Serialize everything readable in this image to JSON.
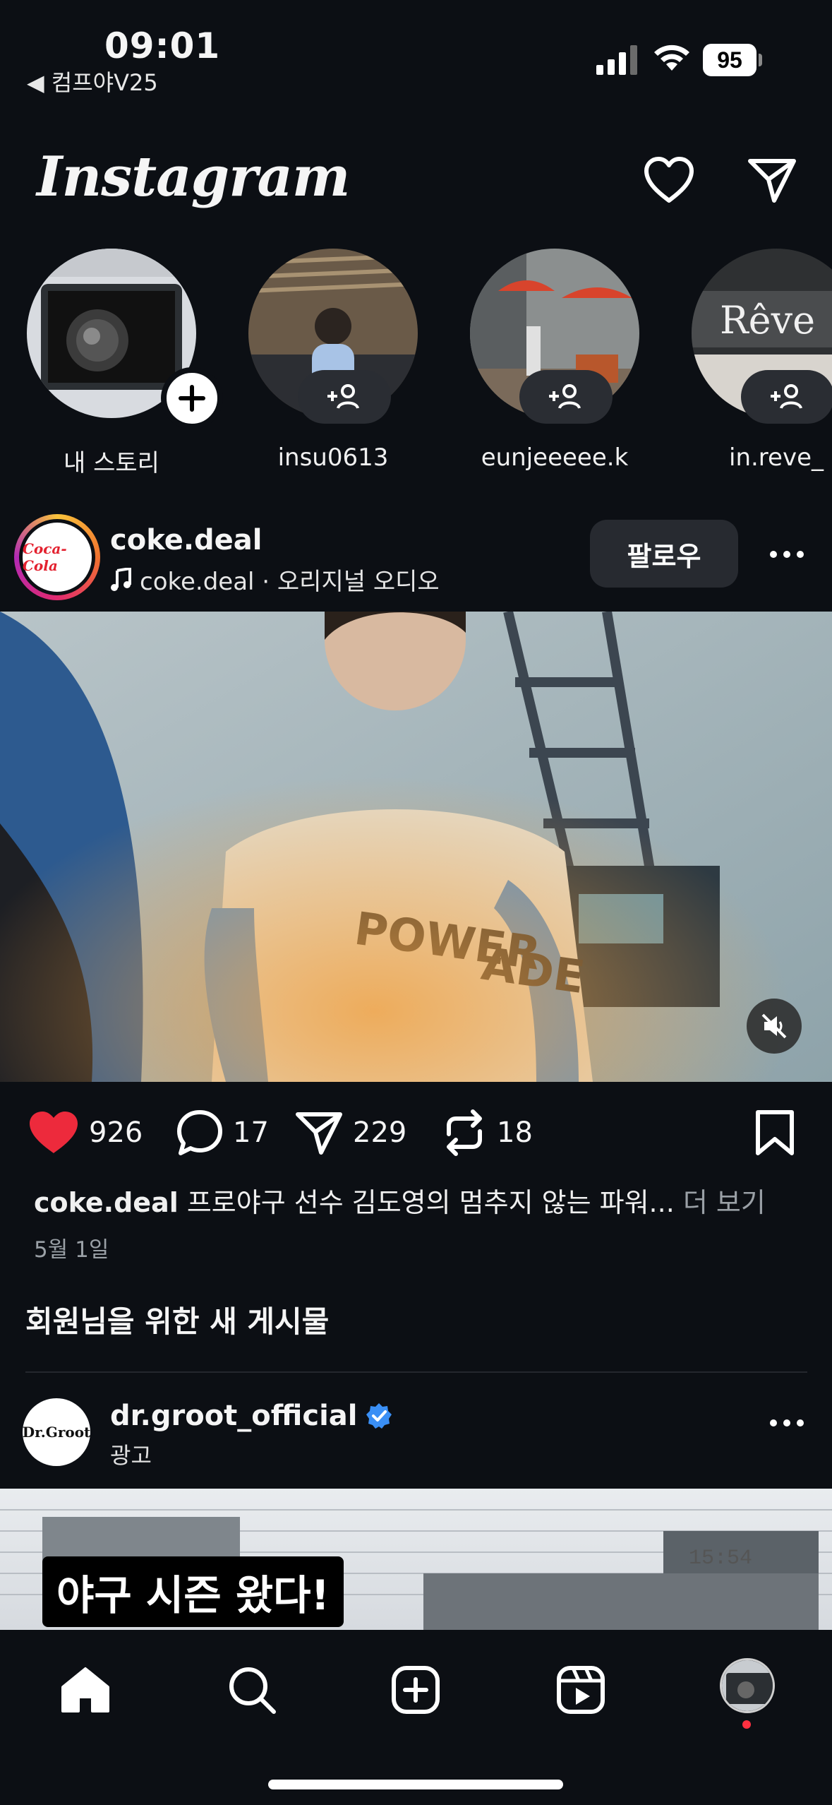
{
  "status": {
    "time": "09:01",
    "back_app": "◀ 컴프야V25",
    "battery": "95"
  },
  "header": {
    "logo": "Instagram"
  },
  "stories": [
    {
      "name": "내 스토리",
      "type": "own"
    },
    {
      "name": "insu0613",
      "type": "suggest"
    },
    {
      "name": "eunjeeeee.k",
      "type": "suggest"
    },
    {
      "name": "in.reve_",
      "type": "suggest"
    }
  ],
  "post": {
    "username": "coke.deal",
    "audio": "coke.deal · 오리지널 오디오",
    "avatar_text": "Coca-Cola",
    "follow_label": "팔로우",
    "likes": "926",
    "comments": "17",
    "shares": "229",
    "reposts": "18",
    "caption_user": "coke.deal",
    "caption_text": " 프로야구 선수 김도영의 멈추지 않는 파워...",
    "caption_more": " 더 보기",
    "date": "5월 1일",
    "jersey_text": "POWERADE"
  },
  "section": {
    "title": "회원님을 위한 새 게시물"
  },
  "post2": {
    "username": "dr.groot_official",
    "subtitle": "광고",
    "avatar_text": "Dr.Groot",
    "ad_headline": "야구 시즌 왔다!",
    "score_time": "15:54"
  },
  "colors": {
    "background": "#0c0f14",
    "like_red": "#ed2a3c",
    "verified_blue": "#3a8ff5",
    "notification_dot": "#ff3040"
  }
}
